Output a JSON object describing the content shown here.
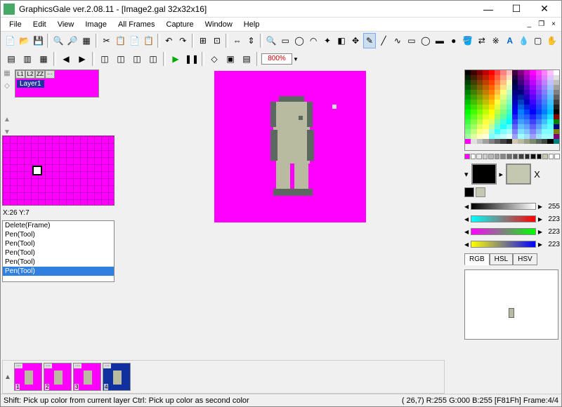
{
  "window": {
    "title": "GraphicsGale ver.2.08.11 - [Image2.gal 32x32x16]",
    "controls": {
      "min": "—",
      "max": "☐",
      "close": "✕"
    }
  },
  "menu": [
    "File",
    "Edit",
    "View",
    "Image",
    "All Frames",
    "Capture",
    "Window",
    "Help"
  ],
  "mdi": {
    "min": "_",
    "restore": "❐",
    "close": "×"
  },
  "zoom": "800%",
  "layer": {
    "label": "Layer1",
    "tabs": [
      "L1",
      "L2",
      "ZZ",
      "···"
    ]
  },
  "coords": "X:26 Y:7",
  "history": [
    "Delete(Frame)",
    "Pen(Tool)",
    "Pen(Tool)",
    "Pen(Tool)",
    "Pen(Tool)",
    "Pen(Tool)"
  ],
  "history_sel": 5,
  "timeline": {
    "frames": [
      1,
      2,
      3,
      4
    ],
    "selected": 4,
    "dots": "···"
  },
  "colors": {
    "fg": "#000000",
    "bg": "#c5c8b0",
    "x": "X"
  },
  "sliders": [
    {
      "val": 255,
      "grad": "linear-gradient(90deg,#000,#fff)"
    },
    {
      "val": 223,
      "grad": "linear-gradient(90deg,#0ff,#f00)"
    },
    {
      "val": 223,
      "grad": "linear-gradient(90deg,#f0f,#0f0)"
    },
    {
      "val": 223,
      "grad": "linear-gradient(90deg,#ff0,#00f)"
    }
  ],
  "colormodes": [
    "RGB",
    "HSL",
    "HSV"
  ],
  "colormode_sel": 0,
  "status": {
    "left": "Shift: Pick up color from current layer  Ctrl: Pick up color as second color",
    "right": "( 26,7) R:255 G:000 B:255  [F81Fh]  Frame:4/4"
  },
  "palette_colors": [
    "#000000",
    "#400000",
    "#800000",
    "#c00000",
    "#ff0000",
    "#ff4040",
    "#ff8080",
    "#ffc0c0",
    "#400040",
    "#800080",
    "#c000c0",
    "#ff00ff",
    "#ff40ff",
    "#ff80ff",
    "#ffc0ff",
    "#ffffff",
    "#002000",
    "#402000",
    "#802000",
    "#c02000",
    "#ff2000",
    "#ff6040",
    "#ffa080",
    "#ffe0c0",
    "#200040",
    "#600080",
    "#a000c0",
    "#e000ff",
    "#e040ff",
    "#e080ff",
    "#e0c0ff",
    "#e0e0e0",
    "#004000",
    "#404000",
    "#804000",
    "#c04000",
    "#ff4000",
    "#ff8040",
    "#ffc080",
    "#ffffc0",
    "#000040",
    "#400080",
    "#8000c0",
    "#c000ff",
    "#c040ff",
    "#c080ff",
    "#c0c0ff",
    "#c0c0c0",
    "#006000",
    "#406000",
    "#806000",
    "#c06000",
    "#ff6000",
    "#ffa040",
    "#ffe080",
    "#e0ffc0",
    "#000060",
    "#200080",
    "#6000c0",
    "#a000ff",
    "#a040ff",
    "#a080ff",
    "#a0c0ff",
    "#a0a0a0",
    "#008000",
    "#408000",
    "#808000",
    "#c08000",
    "#ff8000",
    "#ffc040",
    "#ffff80",
    "#c0ffc0",
    "#000080",
    "#000080",
    "#4000c0",
    "#8000ff",
    "#8040ff",
    "#8080ff",
    "#80c0ff",
    "#808080",
    "#00a000",
    "#40a000",
    "#80a000",
    "#c0a000",
    "#ffa000",
    "#ffe040",
    "#e0ff80",
    "#a0ffc0",
    "#0000a0",
    "#0020a0",
    "#2000c0",
    "#6000ff",
    "#6040ff",
    "#6080ff",
    "#60c0ff",
    "#606060",
    "#00c000",
    "#40c000",
    "#80c000",
    "#c0c000",
    "#ffc000",
    "#ffff40",
    "#c0ff80",
    "#80ffc0",
    "#0000c0",
    "#0040c0",
    "#0000c0",
    "#4000ff",
    "#4040ff",
    "#4080ff",
    "#40c0ff",
    "#404040",
    "#00e000",
    "#40e000",
    "#80e000",
    "#c0e000",
    "#ffe000",
    "#e0ff40",
    "#a0ff80",
    "#60ffc0",
    "#0000e0",
    "#0060e0",
    "#0020e0",
    "#2000ff",
    "#2040ff",
    "#2080ff",
    "#20c0ff",
    "#202020",
    "#00ff00",
    "#40ff00",
    "#80ff00",
    "#c0ff00",
    "#ffff00",
    "#c0ff40",
    "#80ff80",
    "#40ffc0",
    "#0000ff",
    "#0080ff",
    "#0040ff",
    "#0000ff",
    "#0040ff",
    "#0080ff",
    "#00c0ff",
    "#000000",
    "#20ff20",
    "#60ff20",
    "#a0ff20",
    "#e0ff20",
    "#ffff20",
    "#a0ff60",
    "#60ffa0",
    "#20ffe0",
    "#2020ff",
    "#2080ff",
    "#2060ff",
    "#2020ff",
    "#2060ff",
    "#20a0ff",
    "#20e0ff",
    "#800000",
    "#40ff40",
    "#80ff40",
    "#c0ff40",
    "#ffff40",
    "#e0ff60",
    "#80ffa0",
    "#40ffe0",
    "#00ffff",
    "#4040ff",
    "#40a0ff",
    "#4080ff",
    "#4040ff",
    "#4080ff",
    "#40c0ff",
    "#40ffff",
    "#008000",
    "#60ff60",
    "#a0ff60",
    "#e0ff60",
    "#ffff60",
    "#c0ffa0",
    "#60ffe0",
    "#20ffff",
    "#60ffff",
    "#6060ff",
    "#60c0ff",
    "#60a0ff",
    "#6060ff",
    "#60a0ff",
    "#60e0ff",
    "#60ffff",
    "#000080",
    "#80ff80",
    "#c0ff80",
    "#ffff80",
    "#ffffa0",
    "#a0ffe0",
    "#40ffff",
    "#80ffff",
    "#a0ffff",
    "#8080ff",
    "#80e0ff",
    "#80c0ff",
    "#8080ff",
    "#80c0ff",
    "#80ffff",
    "#80ffff",
    "#808000",
    "#a0ffa0",
    "#e0ffa0",
    "#ffffc0",
    "#ffffe0",
    "#80ffff",
    "#a0ffff",
    "#c0ffff",
    "#e0ffff",
    "#a0a0ff",
    "#a0ffff",
    "#a0e0ff",
    "#a0a0ff",
    "#a0e0ff",
    "#a0ffff",
    "#a0ffff",
    "#800080",
    "#ff00ff",
    "#e0e0e0",
    "#c0c0c0",
    "#a0a0a0",
    "#808080",
    "#606060",
    "#404040",
    "#202020",
    "#d0c8b0",
    "#b8bba0",
    "#9aa088",
    "#7c8870",
    "#5a6860",
    "#3c4840",
    "#000000",
    "#008080"
  ],
  "gray_row": [
    "#ff00ff",
    "#fff",
    "#e8e8e8",
    "#d0d0d0",
    "#b8b8b8",
    "#a0a0a0",
    "#888",
    "#707070",
    "#585858",
    "#404040",
    "#282828",
    "#101010",
    "#000",
    "#c5c8b0",
    "#fff",
    "#fff"
  ]
}
